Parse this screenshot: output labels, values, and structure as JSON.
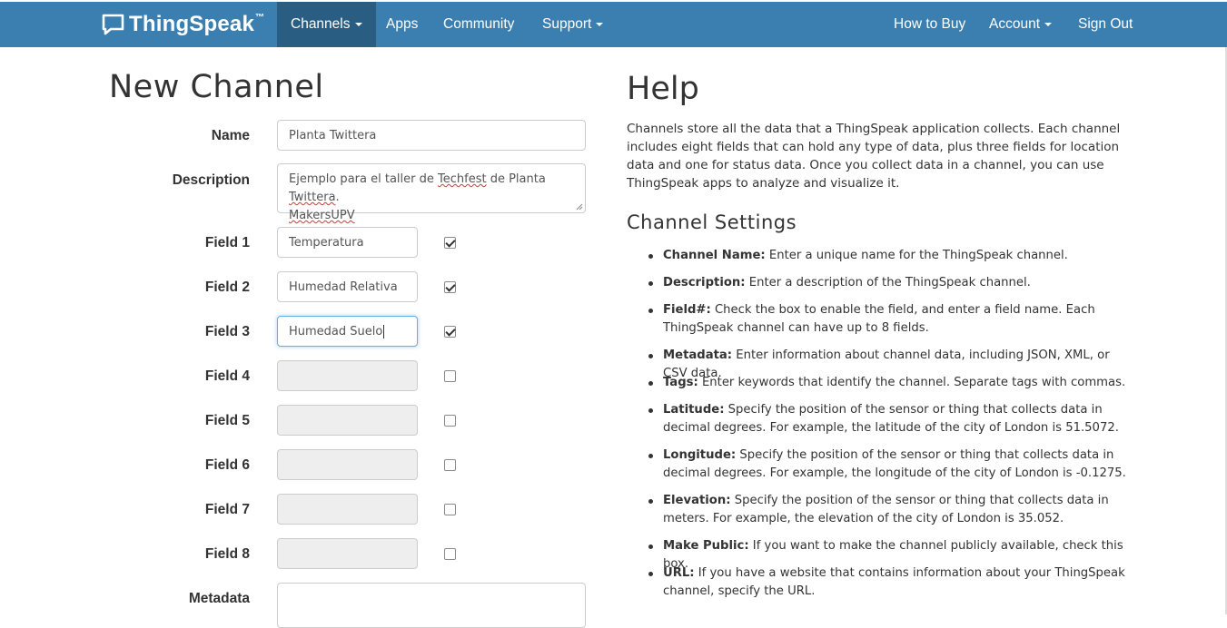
{
  "navbar": {
    "brand": "ThingSpeak",
    "brand_tm": "™",
    "items_left": [
      {
        "label": "Channels",
        "caret": true,
        "active": true
      },
      {
        "label": "Apps",
        "caret": false
      },
      {
        "label": "Community",
        "caret": false
      },
      {
        "label": "Support",
        "caret": true
      }
    ],
    "items_right": [
      {
        "label": "How to Buy",
        "caret": false
      },
      {
        "label": "Account",
        "caret": true
      },
      {
        "label": "Sign Out",
        "caret": false
      }
    ],
    "color": "#3b7fb0",
    "active_color": "#2a5d82"
  },
  "form": {
    "title": "New Channel",
    "name_label": "Name",
    "name_value": "Planta Twittera",
    "description_label": "Description",
    "description_parts": [
      "Ejemplo para el taller de ",
      "Techfest",
      " de Planta ",
      "Twittera",
      ".",
      "MakersUPV"
    ],
    "fields": [
      {
        "label": "Field 1",
        "value": "Temperatura",
        "checked": true
      },
      {
        "label": "Field 2",
        "value": "Humedad Relativa",
        "checked": true
      },
      {
        "label": "Field 3",
        "value": "Humedad Suelo",
        "checked": true
      },
      {
        "label": "Field 4",
        "value": "",
        "checked": false
      },
      {
        "label": "Field 5",
        "value": "",
        "checked": false
      },
      {
        "label": "Field 6",
        "value": "",
        "checked": false
      },
      {
        "label": "Field 7",
        "value": "",
        "checked": false
      },
      {
        "label": "Field 8",
        "value": "",
        "checked": false
      }
    ],
    "metadata_label": "Metadata"
  },
  "help": {
    "title": "Help",
    "intro": "Channels store all the data that a ThingSpeak application collects. Each channel includes eight fields that can hold any type of data, plus three fields for location data and one for status data. Once you collect data in a channel, you can use ThingSpeak apps to analyze and visualize it.",
    "settings_title": "Channel Settings",
    "items": [
      {
        "term": "Channel Name:",
        "text": " Enter a unique name for the ThingSpeak channel."
      },
      {
        "term": "Description:",
        "text": " Enter a description of the ThingSpeak channel."
      },
      {
        "term": "Field#:",
        "text": " Check the box to enable the field, and enter a field name. Each ThingSpeak channel can have up to 8 fields."
      },
      {
        "term": "Metadata:",
        "text": " Enter information about channel data, including JSON, XML, or CSV data."
      },
      {
        "term": "Tags:",
        "text": " Enter keywords that identify the channel. Separate tags with commas."
      },
      {
        "term": "Latitude:",
        "text": " Specify the position of the sensor or thing that collects data in decimal degrees. For example, the latitude of the city of London is 51.5072."
      },
      {
        "term": "Longitude:",
        "text": " Specify the position of the sensor or thing that collects data in decimal degrees. For example, the longitude of the city of London is -0.1275."
      },
      {
        "term": "Elevation:",
        "text": " Specify the position of the sensor or thing that collects data in meters. For example, the elevation of the city of London is 35.052."
      },
      {
        "term": "Make Public:",
        "text": " If you want to make the channel publicly available, check this box."
      },
      {
        "term": "URL:",
        "text": " If you have a website that contains information about your ThingSpeak channel, specify the URL."
      }
    ]
  }
}
